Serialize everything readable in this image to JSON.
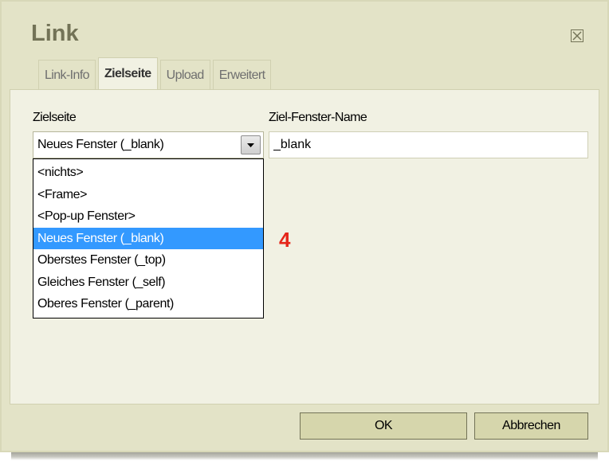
{
  "dialog": {
    "title": "Link",
    "close_icon": "close-icon"
  },
  "tabs": [
    {
      "label": "Link-Info",
      "active": false
    },
    {
      "label": "Zielseite",
      "active": true
    },
    {
      "label": "Upload",
      "active": false
    },
    {
      "label": "Erweitert",
      "active": false
    }
  ],
  "target": {
    "label": "Zielseite",
    "selected_value": "Neues Fenster (_blank)",
    "options": [
      "<nichts>",
      "<Frame>",
      "<Pop-up Fenster>",
      "Neues Fenster (_blank)",
      "Oberstes Fenster (_top)",
      "Gleiches Fenster (_self)",
      "Oberes Fenster (_parent)"
    ],
    "highlighted_index": 3
  },
  "window_name": {
    "label": "Ziel-Fenster-Name",
    "value": "_blank"
  },
  "annotation": "4",
  "buttons": {
    "ok": "OK",
    "cancel": "Abbrechen"
  },
  "colors": {
    "dialog_bg": "#e3e3c7",
    "title": "#737357",
    "highlight": "#3399ff",
    "annotation": "#e5261a"
  }
}
